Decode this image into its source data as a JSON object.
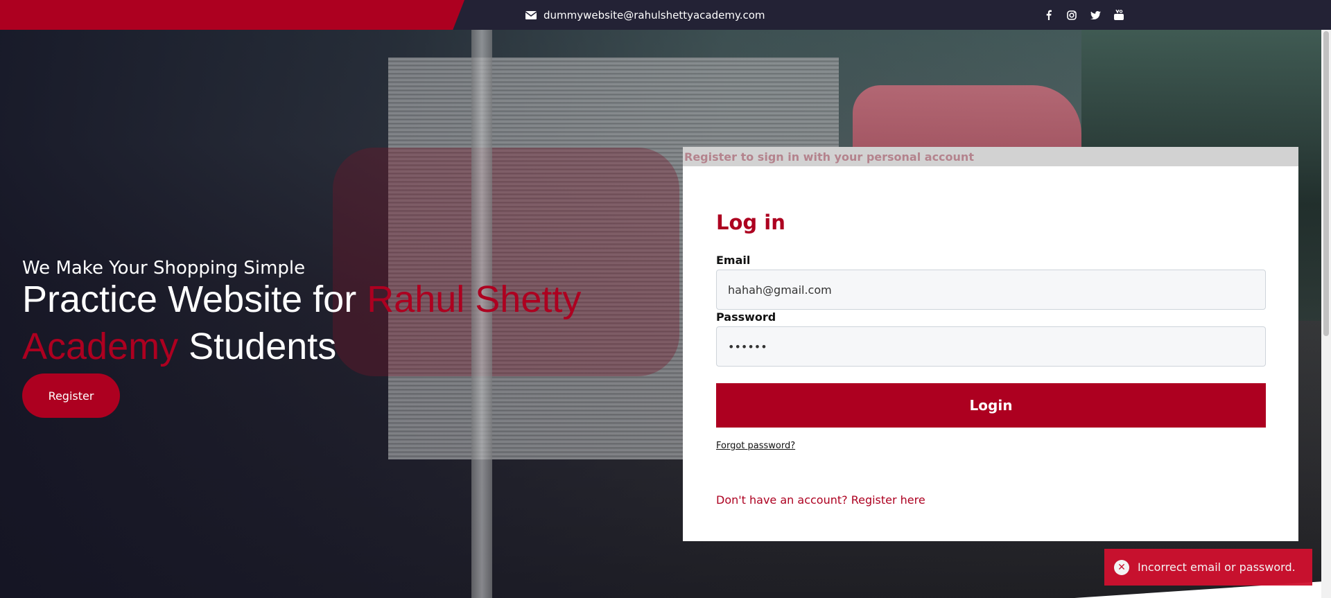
{
  "topbar": {
    "email": "dummywebsite@rahulshettyacademy.com",
    "social": [
      "facebook-icon",
      "instagram-icon",
      "twitter-icon",
      "youtube-icon"
    ]
  },
  "hero": {
    "tagline": "We Make Your Shopping Simple",
    "headline_pre": "Practice Website for ",
    "headline_accent": "Rahul Shetty Academy",
    "headline_post": " Students",
    "register_label": "Register"
  },
  "login": {
    "banner": "Register to sign in with your personal account",
    "title": "Log in",
    "email_label": "Email",
    "email_value": "hahah@gmail.com",
    "password_label": "Password",
    "password_value": "••••••",
    "login_label": "Login",
    "forgot_label": "Forgot password?",
    "register_link": "Don't have an account? Register here"
  },
  "toast": {
    "message": "Incorrect email or password."
  },
  "colors": {
    "accent": "#ad0020",
    "topbar": "#232235",
    "toast": "#d0112f"
  }
}
